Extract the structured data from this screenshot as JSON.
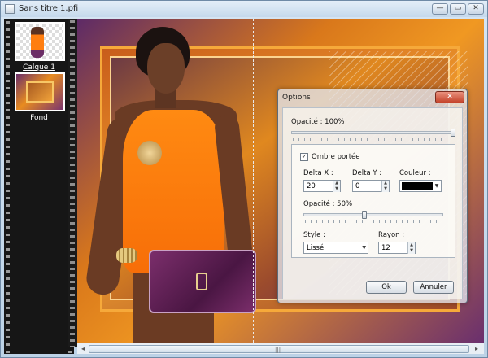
{
  "window": {
    "title": "Sans titre 1.pfi",
    "controls": {
      "minimize": "—",
      "maximize": "▭",
      "close": "✕"
    }
  },
  "layers": [
    {
      "label": "Calque 1",
      "selected": true
    },
    {
      "label": "Fond",
      "selected": false
    }
  ],
  "scrollbar": {
    "left_arrow": "◂",
    "right_arrow": "▸",
    "grip": "|||"
  },
  "dialog": {
    "title": "Options",
    "close_label": "✕",
    "opacity_label": "Opacité : 100%",
    "opacity_value": 100,
    "shadow_checkbox_label": "Ombre portée",
    "shadow_checked": true,
    "check_mark": "✓",
    "delta_x_label": "Delta X :",
    "delta_x_value": "20",
    "delta_y_label": "Delta Y :",
    "delta_y_value": "0",
    "color_label": "Couleur :",
    "color_value": "#000000",
    "shadow_opacity_label": "Opacité : 50%",
    "shadow_opacity_value": 50,
    "style_label": "Style :",
    "style_value": "Lissé",
    "radius_label": "Rayon :",
    "radius_value": "12",
    "ok_label": "Ok",
    "cancel_label": "Annuler",
    "spin_up": "▲",
    "spin_down": "▼",
    "dropdown_arrow": "▼"
  }
}
